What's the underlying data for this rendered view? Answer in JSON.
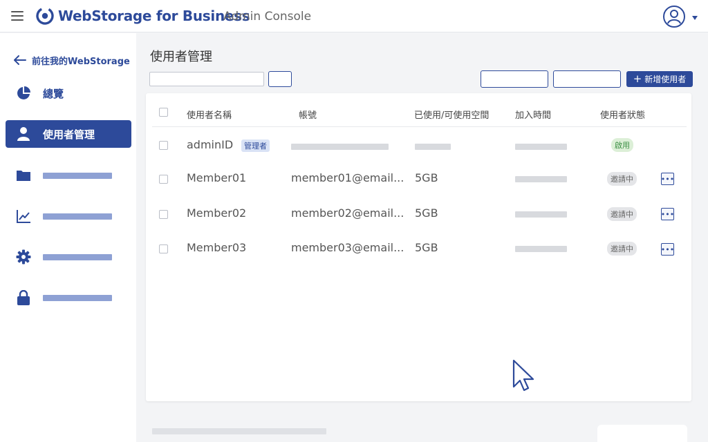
{
  "app": {
    "brand": "WebStorage for Business",
    "subtitle": "Admin Console",
    "accent_color": "#2d4a9a"
  },
  "topbar": {
    "menu_icon": "hamburger-icon",
    "logo_icon": "webstorage-logo-icon",
    "user_icon": "user-circle-icon"
  },
  "sidebar": {
    "back_label": "前往我的WebStorage",
    "items": [
      {
        "label": "總覽",
        "icon": "pie-chart-icon"
      },
      {
        "label": "使用者管理",
        "icon": "user-icon",
        "active": true
      },
      {
        "label": "",
        "icon": "folder-icon"
      },
      {
        "label": "",
        "icon": "line-chart-icon"
      },
      {
        "label": "",
        "icon": "gear-icon"
      },
      {
        "label": "",
        "icon": "lock-icon"
      }
    ]
  },
  "main": {
    "title": "使用者管理",
    "search_placeholder": "",
    "add_button_label": "新增使用者"
  },
  "table": {
    "columns": [
      "使用者名稱",
      "帳號",
      "已使用/可使用空間",
      "加入時間",
      "使用者狀態"
    ],
    "rows": [
      {
        "name": "adminID",
        "role_badge": "管理者",
        "account": "",
        "space": "",
        "joined": "",
        "status": "啟用",
        "status_type": "active"
      },
      {
        "name": "Member01",
        "account": "member01@email...",
        "space": "5GB",
        "joined": "",
        "status": "邀請中",
        "status_type": "invite"
      },
      {
        "name": "Member02",
        "account": "member02@email...",
        "space": "5GB",
        "joined": "",
        "status": "邀請中",
        "status_type": "invite"
      },
      {
        "name": "Member03",
        "account": "member03@email...",
        "space": "5GB",
        "joined": "",
        "status": "邀請中",
        "status_type": "invite"
      }
    ]
  },
  "status_colors": {
    "active": "#3c8f45",
    "invite": "#666666"
  }
}
